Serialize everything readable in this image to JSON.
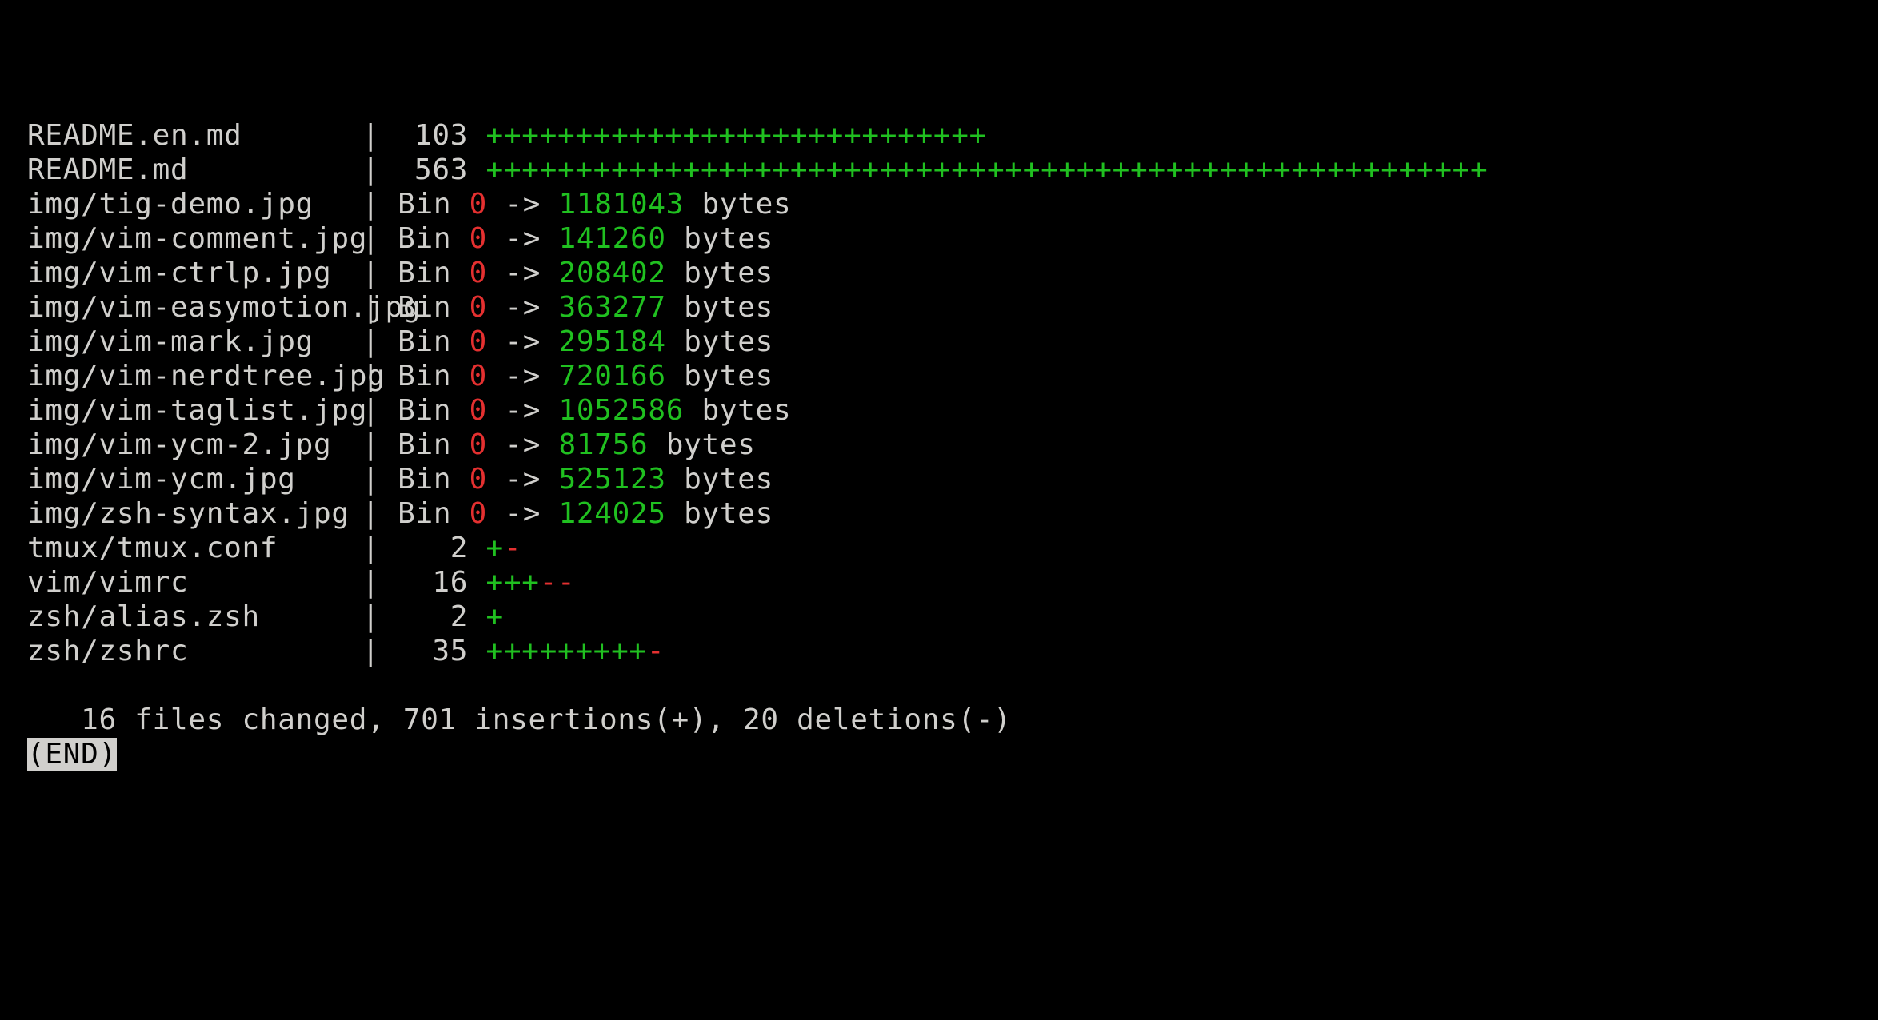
{
  "files": [
    {
      "name": "README.en.md",
      "type": "text",
      "stat": 103,
      "plus": "++++++++++++++++++++++++++++",
      "minus": ""
    },
    {
      "name": "README.md",
      "type": "text",
      "stat": 563,
      "plus": "++++++++++++++++++++++++++++++++++++++++++++++++++++++++",
      "minus": ""
    },
    {
      "name": "img/tig-demo.jpg",
      "type": "bin",
      "from": 0,
      "to": 1181043
    },
    {
      "name": "img/vim-comment.jpg",
      "type": "bin",
      "from": 0,
      "to": 141260
    },
    {
      "name": "img/vim-ctrlp.jpg",
      "type": "bin",
      "from": 0,
      "to": 208402
    },
    {
      "name": "img/vim-easymotion.jpg",
      "type": "bin",
      "from": 0,
      "to": 363277
    },
    {
      "name": "img/vim-mark.jpg",
      "type": "bin",
      "from": 0,
      "to": 295184
    },
    {
      "name": "img/vim-nerdtree.jpg",
      "type": "bin",
      "from": 0,
      "to": 720166
    },
    {
      "name": "img/vim-taglist.jpg",
      "type": "bin",
      "from": 0,
      "to": 1052586
    },
    {
      "name": "img/vim-ycm-2.jpg",
      "type": "bin",
      "from": 0,
      "to": 81756
    },
    {
      "name": "img/vim-ycm.jpg",
      "type": "bin",
      "from": 0,
      "to": 525123
    },
    {
      "name": "img/zsh-syntax.jpg",
      "type": "bin",
      "from": 0,
      "to": 124025
    },
    {
      "name": "tmux/tmux.conf",
      "type": "text",
      "stat": 2,
      "plus": "+",
      "minus": "-"
    },
    {
      "name": "vim/vimrc",
      "type": "text",
      "stat": 16,
      "plus": "+++",
      "minus": "--"
    },
    {
      "name": "zsh/alias.zsh",
      "type": "text",
      "stat": 2,
      "plus": "+",
      "minus": ""
    },
    {
      "name": "zsh/zshrc",
      "type": "text",
      "stat": 35,
      "plus": "+++++++++",
      "minus": "-"
    }
  ],
  "labels": {
    "pipe": "|",
    "bin": "Bin ",
    "arrow": " -> ",
    "bytes": " bytes"
  },
  "summary": " 16 files changed, 701 insertions(+), 20 deletions(-)",
  "end": "(END)"
}
